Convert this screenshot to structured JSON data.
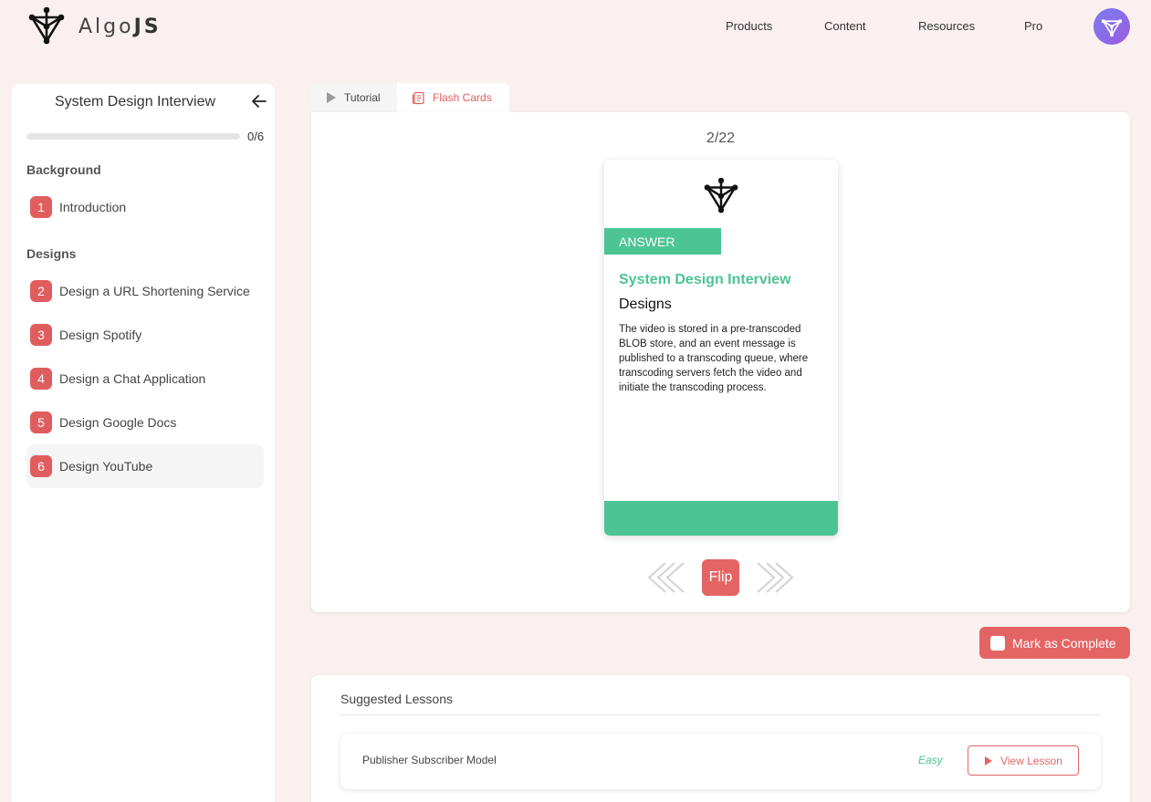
{
  "header": {
    "brand_left": "Algo",
    "brand_right": "JS",
    "nav": [
      {
        "label": "Products"
      },
      {
        "label": "Content"
      },
      {
        "label": "Resources"
      },
      {
        "label": "Pro"
      }
    ]
  },
  "sidebar": {
    "title": "System Design Interview",
    "progress": {
      "text": "0/6",
      "fraction": 0
    },
    "sections": [
      {
        "label": "Background",
        "lessons": [
          {
            "num": "1",
            "label": "Introduction"
          }
        ]
      },
      {
        "label": "Designs",
        "lessons": [
          {
            "num": "2",
            "label": "Design a URL Shortening Service"
          },
          {
            "num": "3",
            "label": "Design Spotify"
          },
          {
            "num": "4",
            "label": "Design a Chat Application"
          },
          {
            "num": "5",
            "label": "Design Google Docs"
          },
          {
            "num": "6",
            "label": "Design YouTube"
          }
        ]
      }
    ]
  },
  "tabs": {
    "tutorial": "Tutorial",
    "flash_cards": "Flash Cards"
  },
  "flashcard": {
    "counter": "2/22",
    "side_label": "ANSWER",
    "course": "System Design Interview",
    "section": "Designs",
    "body": "The video is stored in a pre-transcoded BLOB store, and an event message is published to a transcoding queue, where transcoding servers fetch the video and initiate the transcoding process.",
    "flip_label": "Flip"
  },
  "mark_complete": "Mark as Complete",
  "suggested": {
    "title": "Suggested Lessons",
    "items": [
      {
        "name": "Publisher Subscriber Model",
        "level": "Easy",
        "action": "View Lesson"
      }
    ]
  },
  "colors": {
    "accent_red": "#e46464",
    "accent_green": "#4cc494",
    "background": "#faf0f0"
  }
}
